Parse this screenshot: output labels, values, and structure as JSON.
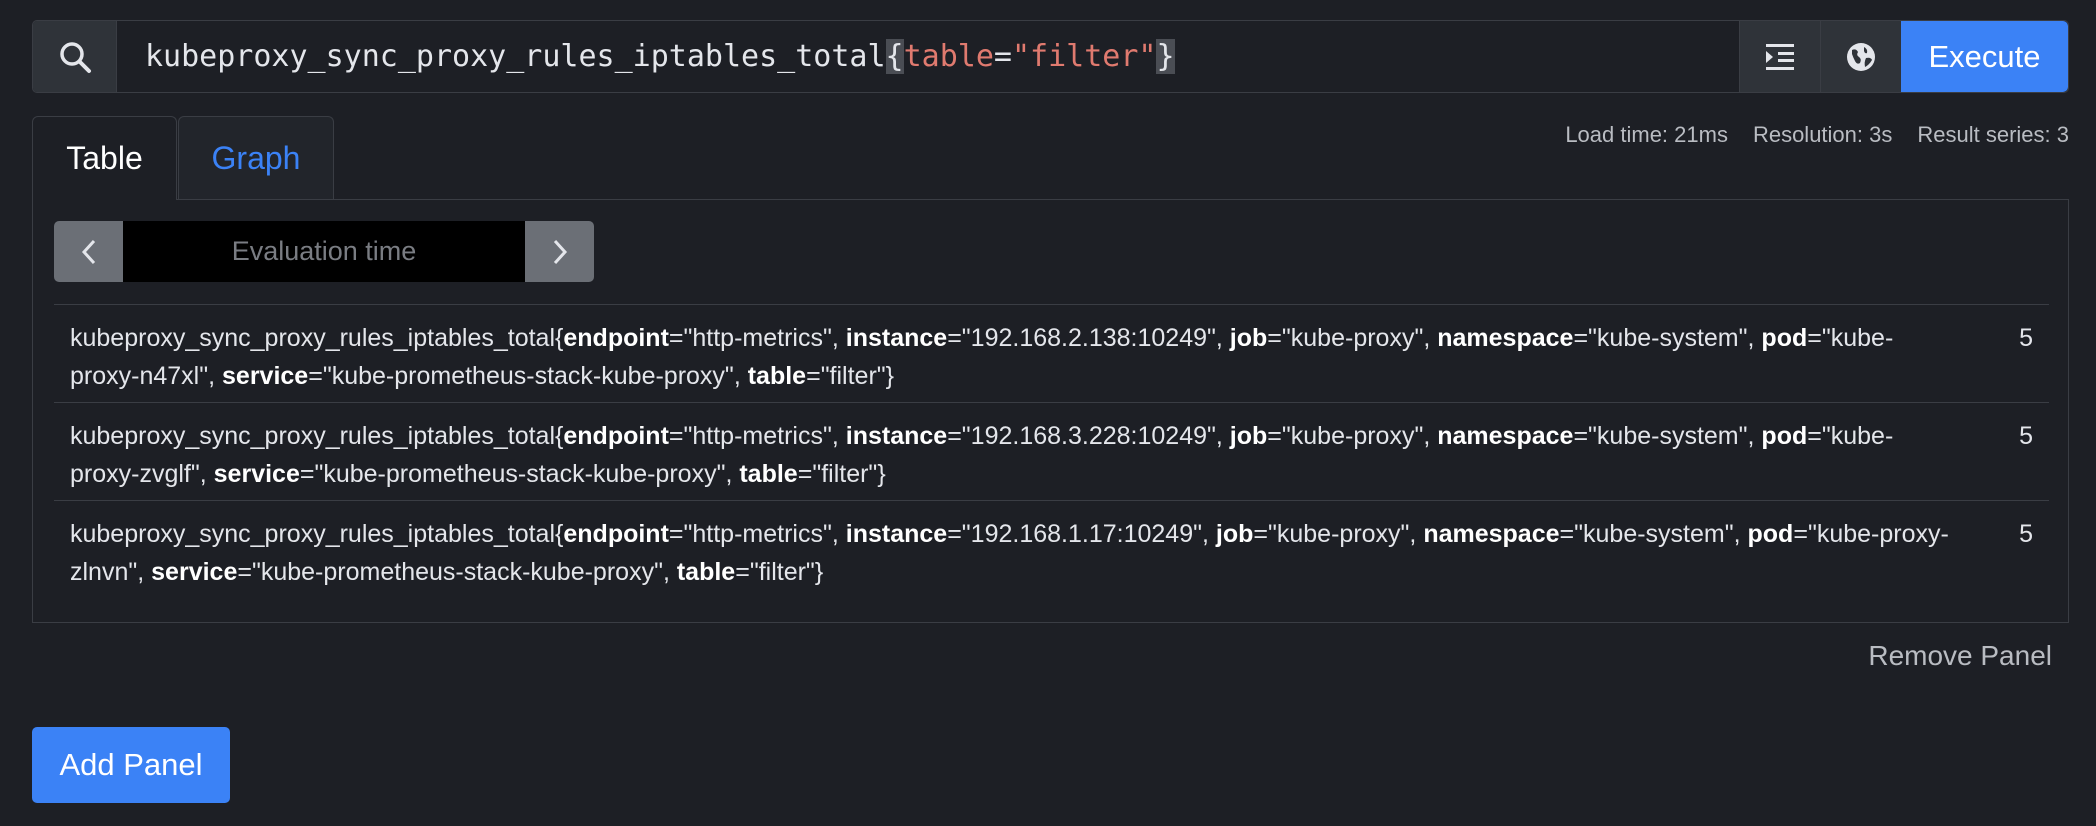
{
  "query": {
    "metric": "kubeproxy_sync_proxy_rules_iptables_total",
    "brace_open": "{",
    "label_name": "table",
    "operator": "=",
    "label_value": "\"filter\"",
    "brace_close": "}"
  },
  "toolbar": {
    "search_icon": "search-icon",
    "format_icon": "indent-icon",
    "metrics_explorer_icon": "globe-icon",
    "execute_label": "Execute"
  },
  "tabs": {
    "table": "Table",
    "graph": "Graph"
  },
  "stats": {
    "load_time": "Load time: 21ms",
    "resolution": "Resolution: 3s",
    "result_series": "Result series: 3"
  },
  "eval_time": {
    "placeholder": "Evaluation time",
    "prev_icon": "chevron-left-icon",
    "next_icon": "chevron-right-icon"
  },
  "results": [
    {
      "metric": "kubeproxy_sync_proxy_rules_iptables_total",
      "labels": [
        {
          "name": "endpoint",
          "value": "\"http-metrics\""
        },
        {
          "name": "instance",
          "value": "\"192.168.2.138:10249\""
        },
        {
          "name": "job",
          "value": "\"kube-proxy\""
        },
        {
          "name": "namespace",
          "value": "\"kube-system\""
        },
        {
          "name": "pod",
          "value": "\"kube-proxy-n47xl\""
        },
        {
          "name": "service",
          "value": "\"kube-prometheus-stack-kube-proxy\""
        },
        {
          "name": "table",
          "value": "\"filter\""
        }
      ],
      "value": "5"
    },
    {
      "metric": "kubeproxy_sync_proxy_rules_iptables_total",
      "labels": [
        {
          "name": "endpoint",
          "value": "\"http-metrics\""
        },
        {
          "name": "instance",
          "value": "\"192.168.3.228:10249\""
        },
        {
          "name": "job",
          "value": "\"kube-proxy\""
        },
        {
          "name": "namespace",
          "value": "\"kube-system\""
        },
        {
          "name": "pod",
          "value": "\"kube-proxy-zvglf\""
        },
        {
          "name": "service",
          "value": "\"kube-prometheus-stack-kube-proxy\""
        },
        {
          "name": "table",
          "value": "\"filter\""
        }
      ],
      "value": "5"
    },
    {
      "metric": "kubeproxy_sync_proxy_rules_iptables_total",
      "labels": [
        {
          "name": "endpoint",
          "value": "\"http-metrics\""
        },
        {
          "name": "instance",
          "value": "\"192.168.1.17:10249\""
        },
        {
          "name": "job",
          "value": "\"kube-proxy\""
        },
        {
          "name": "namespace",
          "value": "\"kube-system\""
        },
        {
          "name": "pod",
          "value": "\"kube-proxy-zlnvn\""
        },
        {
          "name": "service",
          "value": "\"kube-prometheus-stack-kube-proxy\""
        },
        {
          "name": "table",
          "value": "\"filter\""
        }
      ],
      "value": "5"
    }
  ],
  "remove_panel": "Remove Panel",
  "add_panel": "Add Panel",
  "colors": {
    "background": "#1d1f25",
    "accent": "#3b82f6",
    "label_token": "#e07a6f"
  }
}
